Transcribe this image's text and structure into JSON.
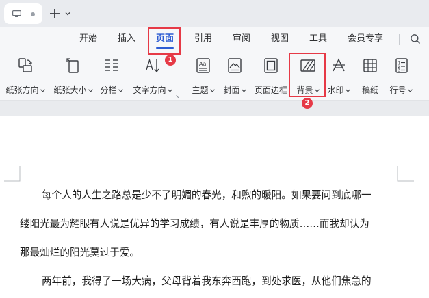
{
  "titlebar": {
    "doc_tab_icon": "monitor-icon",
    "new_tab_icon": "plus-icon"
  },
  "menu": {
    "items": [
      "开始",
      "插入",
      "页面",
      "引用",
      "审阅",
      "视图",
      "工具",
      "会员专享"
    ],
    "active": "页面"
  },
  "ribbon": {
    "tools": [
      {
        "label": "纸张方向",
        "icon": "page-orientation-icon",
        "dropdown": true
      },
      {
        "label": "纸张大小",
        "icon": "page-size-icon",
        "dropdown": true
      },
      {
        "label": "分栏",
        "icon": "columns-icon",
        "dropdown": true
      },
      {
        "label": "文字方向",
        "icon": "text-direction-icon",
        "dropdown": true
      },
      {
        "label": "主题",
        "icon": "theme-icon",
        "dropdown": true
      },
      {
        "label": "封面",
        "icon": "cover-icon",
        "dropdown": true
      },
      {
        "label": "页面边框",
        "icon": "page-border-icon",
        "dropdown": false
      },
      {
        "label": "背景",
        "icon": "background-icon",
        "dropdown": true
      },
      {
        "label": "水印",
        "icon": "watermark-icon",
        "dropdown": true
      },
      {
        "label": "稿纸",
        "icon": "manuscript-paper-icon",
        "dropdown": false
      },
      {
        "label": "行号",
        "icon": "line-number-icon",
        "dropdown": true
      }
    ]
  },
  "annotations": {
    "badge_1": "1",
    "badge_2": "2",
    "color": "#e63946"
  },
  "document": {
    "lines": [
      "每个人的人生之路总是少不了明媚的春光，和煦的暖阳。如果要问到底哪一",
      "缕阳光最为耀眼有人说是优异的学习成绩，有人说是丰厚的物质……而我却认为",
      "那最灿烂的阳光莫过于爱。",
      "两年前，我得了一场大病，父母背着我东奔西跑，到处求医，从他们焦急的"
    ]
  },
  "colors": {
    "accent": "#2d5cd3",
    "highlight": "#e63946"
  }
}
